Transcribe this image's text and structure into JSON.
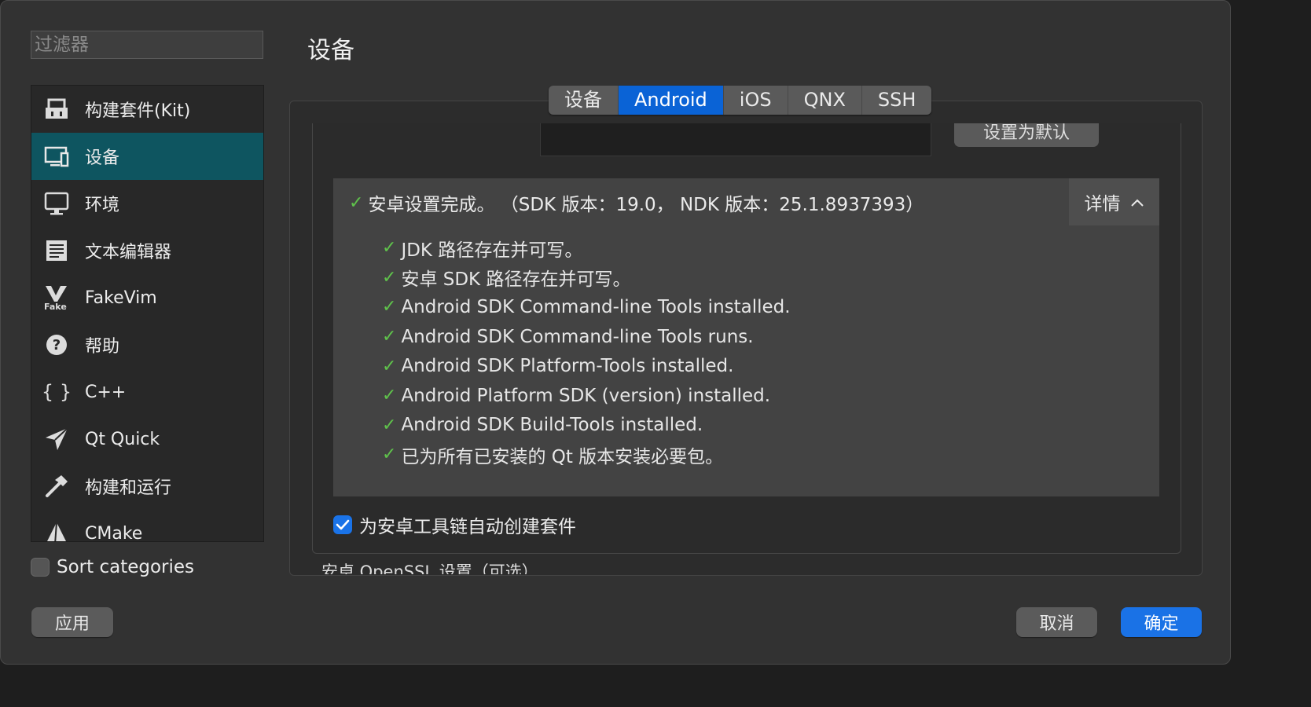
{
  "filter": {
    "placeholder": "过滤器"
  },
  "sidebar": {
    "items": [
      {
        "label": "构建套件(Kit)",
        "icon": "kit-icon"
      },
      {
        "label": "设备",
        "icon": "monitor-icon"
      },
      {
        "label": "环境",
        "icon": "display-icon"
      },
      {
        "label": "文本编辑器",
        "icon": "text-editor-icon"
      },
      {
        "label": "FakeVim",
        "icon": "fakevim-icon"
      },
      {
        "label": "帮助",
        "icon": "help-icon"
      },
      {
        "label": "C++",
        "icon": "braces-icon"
      },
      {
        "label": "Qt Quick",
        "icon": "qtquick-icon"
      },
      {
        "label": "构建和运行",
        "icon": "hammer-icon"
      },
      {
        "label": "CMake",
        "icon": "cmake-icon"
      }
    ],
    "active_index": 1
  },
  "sort_categories": {
    "label": "Sort categories",
    "checked": false
  },
  "page_title": "设备",
  "tabs": [
    {
      "label": "设备"
    },
    {
      "label": "Android",
      "selected": true
    },
    {
      "label": "iOS"
    },
    {
      "label": "QNX"
    },
    {
      "label": "SSH"
    }
  ],
  "set_default_button": "设置为默认",
  "summary": {
    "headline": "安卓设置完成。 （SDK 版本：19.0， NDK 版本：25.1.8937393）",
    "details_label": "详情",
    "items": [
      "JDK 路径存在并可写。",
      "安卓 SDK 路径存在并可写。",
      "Android SDK Command-line Tools installed.",
      "Android SDK Command-line Tools runs.",
      "Android SDK Platform-Tools installed.",
      "Android Platform SDK (version) installed.",
      "Android SDK Build-Tools installed.",
      "已为所有已安装的 Qt 版本安装必要包。"
    ]
  },
  "auto_create_kits": {
    "label": "为安卓工具链自动创建套件",
    "checked": true
  },
  "openssl_section": "安卓 OpenSSL 设置（可选）",
  "buttons": {
    "apply": "应用",
    "cancel": "取消",
    "ok": "确定"
  },
  "colors": {
    "accent": "#1a72e6",
    "selection": "#0e5560",
    "success": "#5fc24b"
  }
}
